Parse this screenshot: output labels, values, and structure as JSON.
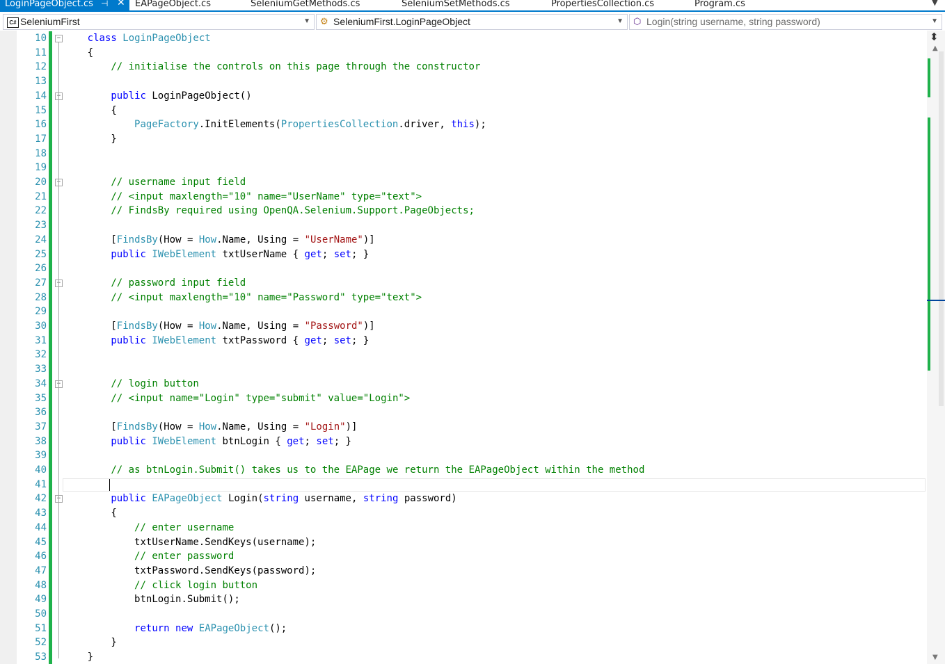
{
  "tabs": [
    {
      "label": "LoginPageObject.cs",
      "active": true
    },
    {
      "label": "EAPageObject.cs",
      "active": false
    },
    {
      "label": "SeleniumGetMethods.cs",
      "active": false
    },
    {
      "label": "SeleniumSetMethods.cs",
      "active": false
    },
    {
      "label": "PropertiesCollection.cs",
      "active": false
    },
    {
      "label": "Program.cs",
      "active": false
    }
  ],
  "tab_icons": {
    "pin": "pin-icon",
    "close": "close-icon",
    "overflow": "chevron-down-icon"
  },
  "navbar": {
    "project": "SeleniumFirst",
    "project_badge": "C#",
    "type": "SeleniumFirst.LoginPageObject",
    "member": "Login(string username, string password)"
  },
  "code_lines": [
    {
      "n": "10",
      "indent": 4,
      "tokens": [
        [
          "kw",
          "class"
        ],
        [
          "p",
          " "
        ],
        [
          "typ",
          "LoginPageObject"
        ]
      ],
      "fold": "minus"
    },
    {
      "n": "11",
      "indent": 4,
      "tokens": [
        [
          "p",
          "{"
        ]
      ]
    },
    {
      "n": "12",
      "indent": 8,
      "tokens": [
        [
          "cmt",
          "// initialise the controls on this page through the constructor"
        ]
      ]
    },
    {
      "n": "13",
      "indent": 0,
      "tokens": []
    },
    {
      "n": "14",
      "indent": 8,
      "tokens": [
        [
          "kw",
          "public"
        ],
        [
          "p",
          " LoginPageObject()"
        ]
      ],
      "fold": "minus"
    },
    {
      "n": "15",
      "indent": 8,
      "tokens": [
        [
          "p",
          "{"
        ]
      ]
    },
    {
      "n": "16",
      "indent": 12,
      "tokens": [
        [
          "typ",
          "PageFactory"
        ],
        [
          "p",
          ".InitElements("
        ],
        [
          "typ",
          "PropertiesCollection"
        ],
        [
          "p",
          ".driver, "
        ],
        [
          "kw",
          "this"
        ],
        [
          "p",
          ");"
        ]
      ]
    },
    {
      "n": "17",
      "indent": 8,
      "tokens": [
        [
          "p",
          "}"
        ]
      ]
    },
    {
      "n": "18",
      "indent": 0,
      "tokens": []
    },
    {
      "n": "19",
      "indent": 0,
      "tokens": []
    },
    {
      "n": "20",
      "indent": 8,
      "tokens": [
        [
          "cmt",
          "// username input field"
        ]
      ],
      "fold": "minus"
    },
    {
      "n": "21",
      "indent": 8,
      "tokens": [
        [
          "cmt",
          "// <input maxlength=\"10\" name=\"UserName\" type=\"text\">"
        ]
      ]
    },
    {
      "n": "22",
      "indent": 8,
      "tokens": [
        [
          "cmt",
          "// FindsBy required using OpenQA.Selenium.Support.PageObjects;"
        ]
      ]
    },
    {
      "n": "23",
      "indent": 0,
      "tokens": []
    },
    {
      "n": "24",
      "indent": 8,
      "tokens": [
        [
          "p",
          "["
        ],
        [
          "typ",
          "FindsBy"
        ],
        [
          "p",
          "(How = "
        ],
        [
          "typ",
          "How"
        ],
        [
          "p",
          ".Name, Using = "
        ],
        [
          "str",
          "\"UserName\""
        ],
        [
          "p",
          ")]"
        ]
      ]
    },
    {
      "n": "25",
      "indent": 8,
      "tokens": [
        [
          "kw",
          "public"
        ],
        [
          "p",
          " "
        ],
        [
          "typ",
          "IWebElement"
        ],
        [
          "p",
          " txtUserName { "
        ],
        [
          "kw",
          "get"
        ],
        [
          "p",
          "; "
        ],
        [
          "kw",
          "set"
        ],
        [
          "p",
          "; }"
        ]
      ]
    },
    {
      "n": "26",
      "indent": 0,
      "tokens": []
    },
    {
      "n": "27",
      "indent": 8,
      "tokens": [
        [
          "cmt",
          "// password input field"
        ]
      ],
      "fold": "minus"
    },
    {
      "n": "28",
      "indent": 8,
      "tokens": [
        [
          "cmt",
          "// <input maxlength=\"10\" name=\"Password\" type=\"text\">"
        ]
      ]
    },
    {
      "n": "29",
      "indent": 0,
      "tokens": []
    },
    {
      "n": "30",
      "indent": 8,
      "tokens": [
        [
          "p",
          "["
        ],
        [
          "typ",
          "FindsBy"
        ],
        [
          "p",
          "(How = "
        ],
        [
          "typ",
          "How"
        ],
        [
          "p",
          ".Name, Using = "
        ],
        [
          "str",
          "\"Password\""
        ],
        [
          "p",
          ")]"
        ]
      ]
    },
    {
      "n": "31",
      "indent": 8,
      "tokens": [
        [
          "kw",
          "public"
        ],
        [
          "p",
          " "
        ],
        [
          "typ",
          "IWebElement"
        ],
        [
          "p",
          " txtPassword { "
        ],
        [
          "kw",
          "get"
        ],
        [
          "p",
          "; "
        ],
        [
          "kw",
          "set"
        ],
        [
          "p",
          "; }"
        ]
      ]
    },
    {
      "n": "32",
      "indent": 0,
      "tokens": []
    },
    {
      "n": "33",
      "indent": 0,
      "tokens": []
    },
    {
      "n": "34",
      "indent": 8,
      "tokens": [
        [
          "cmt",
          "// login button"
        ]
      ],
      "fold": "minus"
    },
    {
      "n": "35",
      "indent": 8,
      "tokens": [
        [
          "cmt",
          "// <input name=\"Login\" type=\"submit\" value=\"Login\">"
        ]
      ]
    },
    {
      "n": "36",
      "indent": 0,
      "tokens": []
    },
    {
      "n": "37",
      "indent": 8,
      "tokens": [
        [
          "p",
          "["
        ],
        [
          "typ",
          "FindsBy"
        ],
        [
          "p",
          "(How = "
        ],
        [
          "typ",
          "How"
        ],
        [
          "p",
          ".Name, Using = "
        ],
        [
          "str",
          "\"Login\""
        ],
        [
          "p",
          ")]"
        ]
      ]
    },
    {
      "n": "38",
      "indent": 8,
      "tokens": [
        [
          "kw",
          "public"
        ],
        [
          "p",
          " "
        ],
        [
          "typ",
          "IWebElement"
        ],
        [
          "p",
          " btnLogin { "
        ],
        [
          "kw",
          "get"
        ],
        [
          "p",
          "; "
        ],
        [
          "kw",
          "set"
        ],
        [
          "p",
          "; }"
        ]
      ]
    },
    {
      "n": "39",
      "indent": 0,
      "tokens": []
    },
    {
      "n": "40",
      "indent": 8,
      "tokens": [
        [
          "cmt",
          "// as btnLogin.Submit() takes us to the EAPage we return the EAPageObject within the method"
        ]
      ]
    },
    {
      "n": "41",
      "indent": 0,
      "tokens": [],
      "current": true
    },
    {
      "n": "42",
      "indent": 8,
      "tokens": [
        [
          "kw",
          "public"
        ],
        [
          "p",
          " "
        ],
        [
          "typ",
          "EAPageObject"
        ],
        [
          "p",
          " Login("
        ],
        [
          "kw",
          "string"
        ],
        [
          "p",
          " username, "
        ],
        [
          "kw",
          "string"
        ],
        [
          "p",
          " password)"
        ]
      ],
      "fold": "minus"
    },
    {
      "n": "43",
      "indent": 8,
      "tokens": [
        [
          "p",
          "{"
        ]
      ]
    },
    {
      "n": "44",
      "indent": 12,
      "tokens": [
        [
          "cmt",
          "// enter username"
        ]
      ]
    },
    {
      "n": "45",
      "indent": 12,
      "tokens": [
        [
          "p",
          "txtUserName.SendKeys(username);"
        ]
      ]
    },
    {
      "n": "46",
      "indent": 12,
      "tokens": [
        [
          "cmt",
          "// enter password"
        ]
      ]
    },
    {
      "n": "47",
      "indent": 12,
      "tokens": [
        [
          "p",
          "txtPassword.SendKeys(password);"
        ]
      ]
    },
    {
      "n": "48",
      "indent": 12,
      "tokens": [
        [
          "cmt",
          "// click login button"
        ]
      ]
    },
    {
      "n": "49",
      "indent": 12,
      "tokens": [
        [
          "p",
          "btnLogin.Submit();"
        ]
      ]
    },
    {
      "n": "50",
      "indent": 0,
      "tokens": []
    },
    {
      "n": "51",
      "indent": 12,
      "tokens": [
        [
          "kw",
          "return"
        ],
        [
          "p",
          " "
        ],
        [
          "kw",
          "new"
        ],
        [
          "p",
          " "
        ],
        [
          "typ",
          "EAPageObject"
        ],
        [
          "p",
          "();"
        ]
      ]
    },
    {
      "n": "52",
      "indent": 8,
      "tokens": [
        [
          "p",
          "}"
        ]
      ]
    },
    {
      "n": "53",
      "indent": 4,
      "tokens": [
        [
          "p",
          "}"
        ]
      ]
    }
  ],
  "colors": {
    "keyword": "#0000ff",
    "type": "#2b91af",
    "comment": "#008000",
    "string": "#a31515",
    "line_number": "#2b91af",
    "change_bar": "#1fb24b",
    "accent": "#007acc"
  }
}
